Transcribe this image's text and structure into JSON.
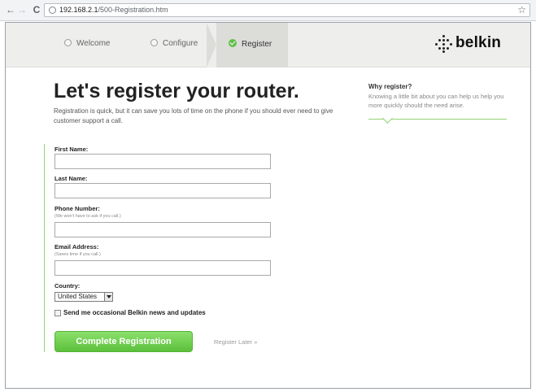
{
  "browser": {
    "url_host": "192.168.2.1",
    "url_path": "/500-Registration.htm",
    "icons": {
      "back": "arrow-left-icon",
      "forward": "arrow-right-icon",
      "reload": "reload-icon",
      "page": "page-info-icon",
      "bookmark": "star-icon"
    }
  },
  "steps": [
    {
      "label": "Welcome",
      "state": "inactive"
    },
    {
      "label": "Configure",
      "state": "inactive"
    },
    {
      "label": "Register",
      "state": "active"
    }
  ],
  "brand": {
    "name": "belkin"
  },
  "main": {
    "title": "Let's register your router.",
    "intro": "Registration is quick, but it can save you lots of time on the phone if you should ever need to give customer support a call."
  },
  "sidebar": {
    "title": "Why register?",
    "text": "Knowing a little bit about you can help us help you more quickly should the need arise."
  },
  "form": {
    "first_name": {
      "label": "First Name:",
      "value": ""
    },
    "last_name": {
      "label": "Last Name:",
      "value": ""
    },
    "phone": {
      "label": "Phone Number:",
      "hint": "(We won't have to ask if you call.)",
      "value": ""
    },
    "email": {
      "label": "Email Address:",
      "hint": "(Saves time if you call.)",
      "value": ""
    },
    "country": {
      "label": "Country:",
      "selected": "United States"
    },
    "newsletter": {
      "label": "Send me occasional Belkin news and updates",
      "checked": false
    },
    "submit_label": "Complete Registration",
    "later_label": "Register Later »"
  },
  "colors": {
    "accent_green": "#62c04a",
    "button_green": "#6fd04f",
    "header_bg": "#eeeeec"
  }
}
